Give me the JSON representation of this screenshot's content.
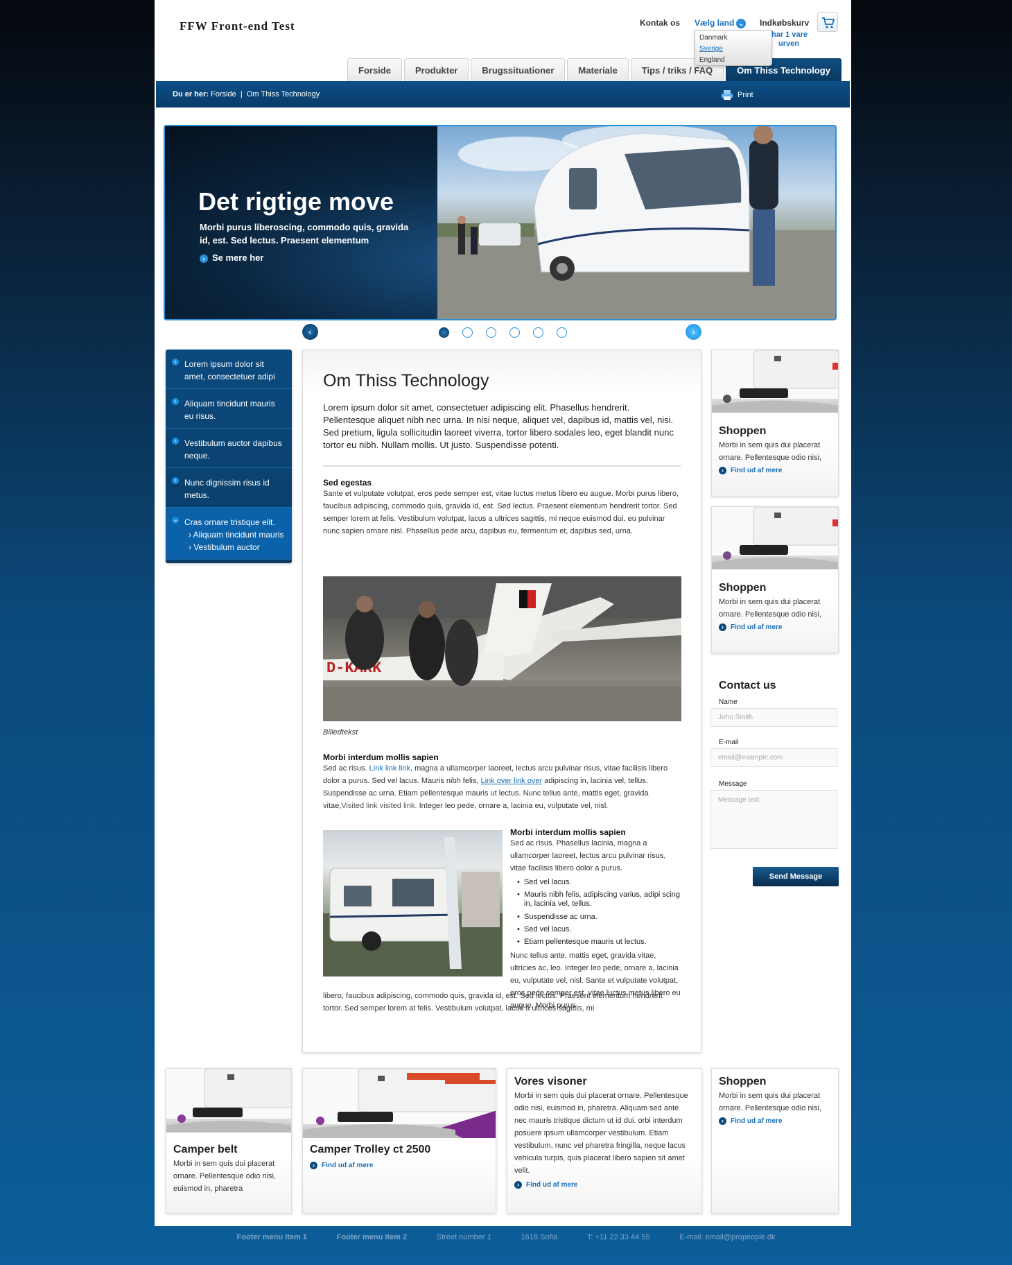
{
  "header": {
    "logo": "FFW Front-end Test",
    "contact_link": "Kontak os",
    "country_label": "Vælg land",
    "cart_label": "Indkøbskurv",
    "cart_info_line1": "har 1 vare",
    "cart_info_line2": "urven",
    "countries": [
      "Danmark",
      "Sverige",
      "England"
    ]
  },
  "nav": {
    "tabs": [
      "Forside",
      "Produkter",
      "Brugssituationer",
      "Materiale",
      "Tips / triks / FAQ",
      "Om Thiss Technology"
    ],
    "active": "Om Thiss Technology"
  },
  "breadcrumb": {
    "label": "Du er her:",
    "home": "Forside",
    "separator": "|",
    "current": "Om Thiss Technology",
    "print": "Print"
  },
  "hero": {
    "title": "Det rigtige move",
    "subtitle": "Morbi purus liberoscing, commodo quis, gravida id, est. Sed lectus. Praesent elementum",
    "more": "Se mere her",
    "slide_count": 6,
    "active_slide": 1
  },
  "leftnav": {
    "items": [
      "Lorem ipsum dolor sit amet, consectetuer adipi",
      "Aliquam tincidunt mauris eu risus.",
      "Vestibulum auctor dapibus neque.",
      "Nunc dignissim risus id metus.",
      "Cras ornare tristique elit."
    ],
    "subitems": [
      "› Aliquam tincidunt mauris",
      "› Vestibulum auctor"
    ]
  },
  "main": {
    "title": "Om Thiss Technology",
    "lead": "Lorem ipsum dolor sit amet, consectetuer adipiscing elit. Phasellus hendrerit. Pellentesque aliquet nibh nec urna. In nisi neque, aliquet vel, dapibus id, mattis vel, nisi. Sed pretium, ligula sollicitudin laoreet viverra, tortor libero sodales leo, eget blandit nunc tortor eu nibh. Nullam mollis. Ut justo. Suspendisse potenti.",
    "s1_title": "Sed egestas",
    "s1_text": "Sante et vulputate volutpat, eros pede semper est, vitae luctus metus libero eu augue. Morbi purus libero, faucibus adipiscing, commodo quis, gravida id, est. Sed lectus. Praesent elementum hendrerit tortor. Sed semper lorem at felis. Vestibulum volutpat, lacus a ultrices sagittis, mi neque euismod dui, eu pulvinar nunc sapien ornare nisl. Phasellus pede arcu, dapibus eu, fermentum et, dapibus sed, urna.",
    "image_caption": "Billedtekst",
    "s2_title": "Morbi interdum mollis sapien",
    "s2_a": "Sed ac risus.",
    "s2_link1": "Link link link,",
    "s2_b": "magna a ullamcorper laoreet, lectus arcu pulvinar risus, vitae facilisis libero dolor a purus. Sed vel lacus. Mauris nibh felis,",
    "s2_link2": "Link over link over",
    "s2_c": "adipiscing in, lacinia vel, tellus. Suspendisse ac urna. Etiam pellentesque mauris ut lectus. Nunc tellus ante, mattis eget, gravida vitae,",
    "s2_link3": "Visited link visited link.",
    "s2_d": "Integer leo pede, ornare a, lacinia eu, vulputate vel, nisl.",
    "s3_title": "Morbi interdum mollis sapien",
    "s3_text": "Sed ac risus. Phasellus lacinia, magna a ullamcorper laoreet, lectus arcu pulvinar risus, vitae facilisis libero dolor a purus.",
    "s3_bullets": [
      "Sed vel lacus.",
      "Mauris nibh felis, adipiscing varius, adipi scing in, lacinia vel, tellus.",
      "Suspendisse ac urna.",
      "Sed vel lacus.",
      "Etiam pellentesque mauris ut lectus."
    ],
    "s3_after": "Nunc tellus ante, mattis eget, gravida vitae, ultricies ac, leo. Integer leo pede, ornare a, lacinia eu, vulputate vel, nisl. Sante et vulputate volutpat, eros pede semper est, vitae luctus metus libero eu augue. Morbi purus",
    "s3_full": "libero, faucibus adipiscing, commodo quis, gravida id, est. Sed lectus. Praesent elementum hendrerit tortor. Sed semper lorem at felis. Vestibulum volutpat, lacus a ultrices sagittis, mi"
  },
  "sidecards": [
    {
      "title": "Shoppen",
      "text": "Morbi in sem quis dui placerat ornare. Pellentesque odio nisi,",
      "link": "Find ud af mere"
    },
    {
      "title": "Shoppen",
      "text": "Morbi in sem quis dui placerat ornare. Pellentesque odio nisi,",
      "link": "Find ud af mere"
    }
  ],
  "contact": {
    "title": "Contact us",
    "name_label": "Name",
    "name_placeholder": "John Smith",
    "email_label": "E-mail",
    "email_placeholder": "email@example.com",
    "message_label": "Message",
    "message_placeholder": "Message text",
    "send": "Send Message"
  },
  "bottomcards": {
    "camper_belt": {
      "title": "Camper belt",
      "text": "Morbi in sem quis dui placerat ornare. Pellentesque odio nisi, euismod in, pharetra"
    },
    "trolley": {
      "title": "Camper Trolley ct 2500",
      "link": "Find ud af mere"
    },
    "visioner": {
      "title": "Vores visoner",
      "text": "Morbi in sem quis dui placerat ornare. Pellentesque odio nisi, euismod in, pharetra. Aliquam sed ante nec mauris tristique dictum ut id dui. orbi interdum posuere ipsum ullamcorper vestibulum. Etiam vestibulum, nunc vel pharetra fringilla, neque lacus vehicula turpis, quis placerat libero sapien sit amet velit.",
      "link": "Find ud af mere"
    },
    "shoppen": {
      "title": "Shoppen",
      "text": "Morbi in sem quis dui placerat ornare. Pellentesque odio nisi,",
      "link": "Find ud af mere"
    }
  },
  "footer": {
    "item1": "Footer menu item 1",
    "item2": "Footer menu item 2",
    "street": "Street number 1",
    "city": "1618 Sofia",
    "phone": "T: +11 22 33 44 55",
    "email": "E-mail: email@propeople.dk",
    "sep": "·"
  },
  "colors": {
    "accent": "#1a6fb8",
    "nav_active": "#0b4a7e",
    "bright_blue": "#2a8fd8"
  }
}
